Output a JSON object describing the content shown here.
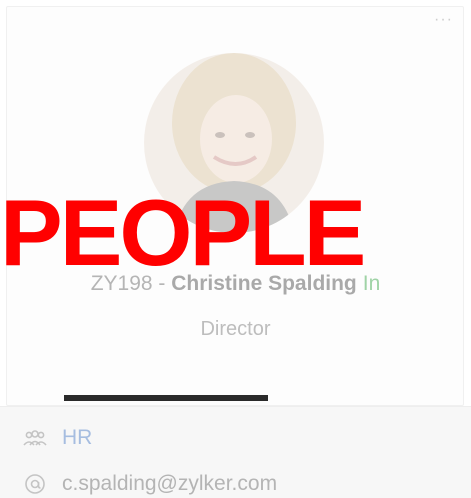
{
  "card": {
    "more_menu": "···",
    "employee_id": "ZY198",
    "separator": " - ",
    "full_name": "Christine Spalding",
    "status": "In",
    "designation": "Director"
  },
  "overlay": {
    "title": "PEOPLE"
  },
  "info": {
    "department": "HR",
    "department_icon": "people-group-icon",
    "email": "c.spalding@zylker.com",
    "email_icon": "at-sign-icon"
  },
  "colors": {
    "overlay_red": "#ff0000",
    "status_green": "#9fd3a6",
    "link_blue": "#a6bde0"
  }
}
